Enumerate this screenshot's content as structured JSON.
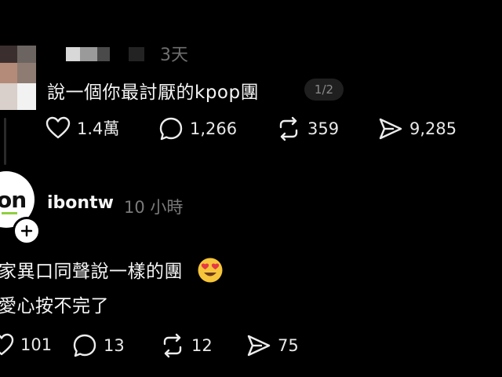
{
  "post1": {
    "time": "3天",
    "text": "說一個你最討厭的kpop團",
    "page_badge": "1/2",
    "likes": "1.4萬",
    "comments": "1,266",
    "reposts": "359",
    "shares": "9,285"
  },
  "post2": {
    "username": "ibontw",
    "time": "10 小時",
    "line1": "家異口同聲說一樣的團",
    "line2": "愛心按不完了",
    "likes": "101",
    "comments": "13",
    "reposts": "12",
    "shares": "75"
  },
  "icons": {
    "like": "heart-icon",
    "comment": "comment-bubble-icon",
    "repost": "repost-icon",
    "share": "send-icon",
    "follow": "plus-icon",
    "emoji": "heart-eyes-emoji"
  },
  "colors": {
    "background": "#000000",
    "text": "#f5f5f5",
    "muted": "#6f6f6f",
    "emoji_face": "#f7c53b",
    "emoji_hearts": "#e53945"
  }
}
